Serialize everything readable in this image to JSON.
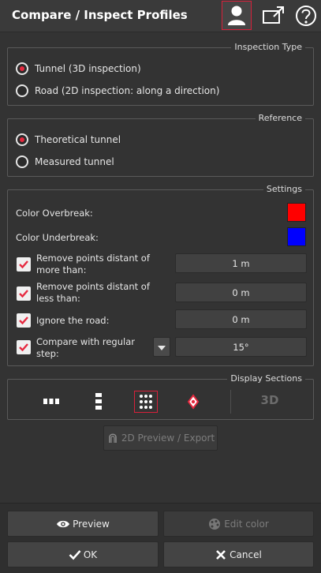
{
  "header": {
    "title": "Compare / Inspect Profiles",
    "user_icon": "user-icon",
    "export_icon": "export-window-icon",
    "help_icon": "help-icon"
  },
  "inspection_type": {
    "legend": "Inspection Type",
    "options": [
      {
        "label": "Tunnel (3D inspection)",
        "selected": true
      },
      {
        "label": "Road (2D inspection: along a direction)",
        "selected": false
      }
    ]
  },
  "reference": {
    "legend": "Reference",
    "options": [
      {
        "label": "Theoretical tunnel",
        "selected": true
      },
      {
        "label": "Measured tunnel",
        "selected": false
      }
    ]
  },
  "settings": {
    "legend": "Settings",
    "overbreak_label": "Color Overbreak:",
    "overbreak_color": "#ff0000",
    "underbreak_label": "Color Underbreak:",
    "underbreak_color": "#0000ff",
    "rows": [
      {
        "label": "Remove points distant of more than:",
        "value": "1 m",
        "checked": true
      },
      {
        "label": "Remove points distant of less than:",
        "value": "0 m",
        "checked": true
      },
      {
        "label": "Ignore the road:",
        "value": "0 m",
        "checked": true
      },
      {
        "label": "Compare with regular step:",
        "value": "15°",
        "checked": true
      }
    ]
  },
  "display_sections": {
    "legend": "Display Sections",
    "buttons": [
      {
        "icon": "sections-horizontal-icon",
        "active": false
      },
      {
        "icon": "sections-vertical-icon",
        "active": false
      },
      {
        "icon": "sections-grid-icon",
        "active": true
      },
      {
        "icon": "section-single-icon",
        "active": false
      }
    ],
    "view3d_label": "3D"
  },
  "preview_export_label": "2D Preview / Export",
  "footer": {
    "preview_label": "Preview",
    "edit_color_label": "Edit color",
    "ok_label": "OK",
    "cancel_label": "Cancel"
  },
  "accent_color": "#e6293f"
}
